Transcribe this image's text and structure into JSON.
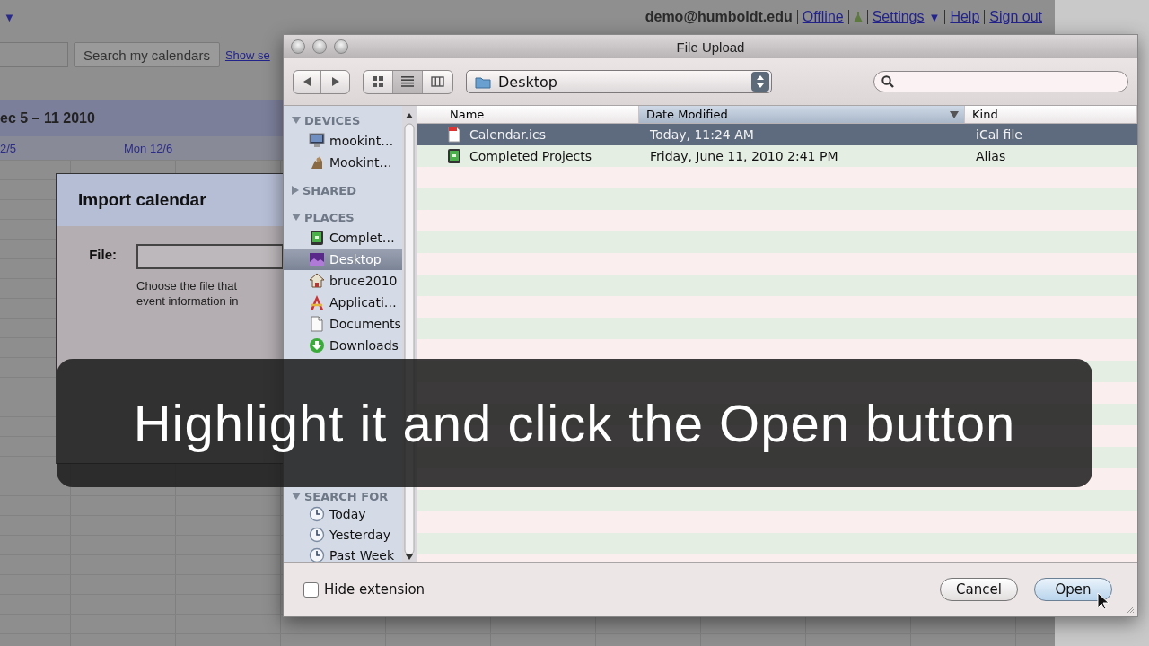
{
  "background_page": {
    "menu_caret": "▼",
    "account": "demo@humboldt.edu",
    "links": [
      {
        "label": "Offline"
      },
      {
        "label": "Settings",
        "caret": "▼"
      },
      {
        "label": "Help"
      },
      {
        "label": "Sign out"
      }
    ],
    "search_button": "Search my calendars",
    "search_link": "Show se",
    "date_range": "ec 5 – 11 2010",
    "day_headers": [
      "2/5",
      "Mon 12/6"
    ]
  },
  "import_dialog": {
    "title": "Import calendar",
    "file_label": "File:",
    "file_help": "Choose the file that\nevent information in"
  },
  "file_dialog": {
    "title": "File Upload",
    "location": "Desktop",
    "sidebar": [
      {
        "label": "DEVICES",
        "expanded": true,
        "items": [
          {
            "label": "mookint…",
            "selected": false
          },
          {
            "label": "Mookint…",
            "selected": false
          }
        ]
      },
      {
        "label": "SHARED",
        "expanded": false
      },
      {
        "label": "PLACES",
        "expanded": true,
        "items": [
          {
            "label": "Complet…",
            "selected": false
          },
          {
            "label": "Desktop",
            "selected": true
          },
          {
            "label": "bruce2010",
            "selected": false
          },
          {
            "label": "Applicati…",
            "selected": false
          },
          {
            "label": "Documents",
            "selected": false
          },
          {
            "label": "Downloads",
            "selected": false
          }
        ]
      },
      {
        "label": "SEARCH FOR",
        "expanded": true,
        "items": [
          {
            "label": "Today",
            "selected": false
          },
          {
            "label": "Yesterday",
            "selected": false
          },
          {
            "label": "Past Week",
            "selected": false
          }
        ]
      }
    ],
    "columns": [
      {
        "label": "Name",
        "sorted": false
      },
      {
        "label": "Date Modified",
        "sorted": true
      },
      {
        "label": "Kind",
        "sorted": false
      }
    ],
    "rows": [
      {
        "name": "Calendar.ics",
        "date_modified": "Today, 11:24 AM",
        "kind": "iCal file",
        "selected": true
      },
      {
        "name": "Completed Projects",
        "date_modified": "Friday, June 11, 2010 2:41 PM",
        "kind": "Alias",
        "selected": false
      }
    ],
    "hide_extension": {
      "label": "Hide extension",
      "checked": false
    },
    "buttons": [
      {
        "label": "Cancel",
        "default": false
      },
      {
        "label": "Open",
        "default": true
      }
    ]
  },
  "caption": "Highlight it and click the Open button"
}
